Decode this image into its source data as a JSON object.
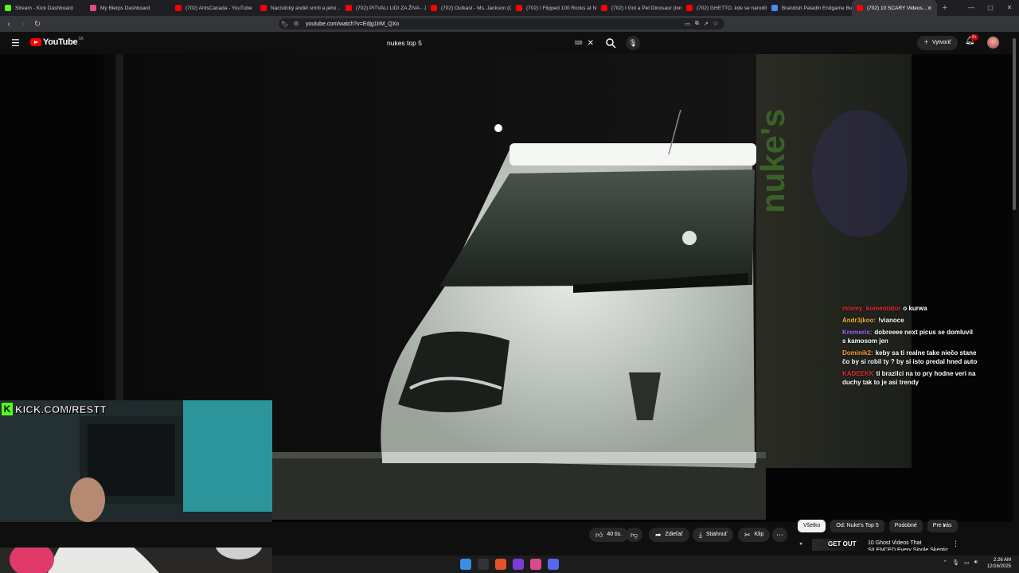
{
  "browser": {
    "tabs": [
      {
        "title": "Stream - Kick Dashboard",
        "icon": "kick-icon",
        "color": "#53fc18"
      },
      {
        "title": "My Blerps Dashboard",
        "icon": "blerp-icon",
        "color": "#e04a8c"
      },
      {
        "title": "(702) AntsCanada - YouTube",
        "icon": "youtube-icon",
        "color": "#ff0000"
      },
      {
        "title": "Nacistický anděl smrti a jeho ...",
        "icon": "youtube-icon",
        "color": "#ff0000"
      },
      {
        "title": "(702) PITVALI LIDI ZA ŽIVA - Je...",
        "icon": "youtube-icon",
        "color": "#ff0000"
      },
      {
        "title": "(702) Outkast - Ms. Jackson (O...",
        "icon": "youtube-icon",
        "color": "#ff0000"
      },
      {
        "title": "(702) I Flipped 100 Rocks at Ni...",
        "icon": "youtube-icon",
        "color": "#ff0000"
      },
      {
        "title": "(702) I Got a Pet Dinosaur (lon...",
        "icon": "youtube-icon",
        "color": "#ff0000"
      },
      {
        "title": "(702) GHETTO, kde se narodil...",
        "icon": "youtube-icon",
        "color": "#ff0000"
      },
      {
        "title": "Brandish Paladin Endgame Bu...",
        "icon": "globe-icon",
        "color": "#4a8af4"
      },
      {
        "title": "(702) 10 SCARY Videos...",
        "icon": "youtube-icon",
        "color": "#ff0000",
        "active": true
      }
    ],
    "url": "youtube.com/watch?v=Edjg1lrM_QXo",
    "ext_badge": "9"
  },
  "youtube": {
    "logo_text": "YouTube",
    "country": "SK",
    "search_query": "nukes top 5",
    "create_label": "Vytvoriť",
    "notif_count": "9+"
  },
  "chat": [
    {
      "user": "mixmy_komentator",
      "text": "o kurwa",
      "color": "#e03030"
    },
    {
      "user": "Andr3jkoo:",
      "text": "!vianoce",
      "color": "#f0b43c"
    },
    {
      "user": "Kremeris:",
      "text": "dobreeee next picus se domluvil s kamosom jen",
      "color": "#a070ff"
    },
    {
      "user": "Dominik2:",
      "text": "keby sa ti realne take niečo stane čo by si robil ty ? by si isto predal hned auto",
      "color": "#ff9a3c"
    },
    {
      "user": "KADEEKK",
      "text": "ti brazilci na to pry hodne veri na duchy tak to je asi trendy",
      "color": "#e03030"
    }
  ],
  "stream_overlay": {
    "brand": "KICK.COM/RESTT"
  },
  "actions": {
    "likes": "40 tis.",
    "share": "Zdieľať",
    "download": "Stiahnuť",
    "clip": "Klip"
  },
  "chips": [
    "Všetko",
    "Od: Nuke's Top 5",
    "Podobné",
    "Pre vás"
  ],
  "recommendation": {
    "thumb_text": "GET OUT",
    "title": "10 Ghost Videos That SILENCED Every Single Skeptic"
  },
  "taskbar": {
    "time": "2:26 AM",
    "date": "12/16/2025"
  },
  "watermark": "nuke's"
}
